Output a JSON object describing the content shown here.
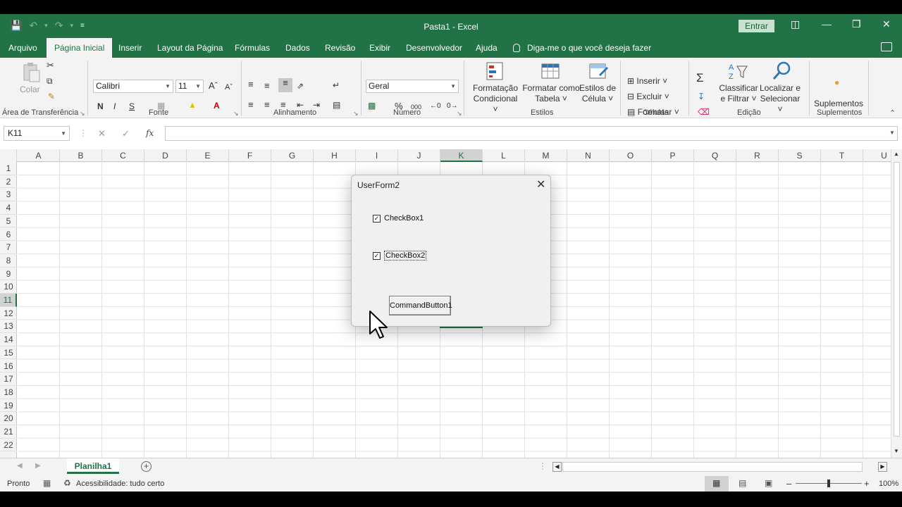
{
  "window": {
    "title": "Pasta1  -  Excel",
    "signin": "Entrar"
  },
  "tabs": [
    "Arquivo",
    "Página Inicial",
    "Inserir",
    "Layout da Página",
    "Fórmulas",
    "Dados",
    "Revisão",
    "Exibir",
    "Desenvolvedor",
    "Ajuda"
  ],
  "tell_me": "Diga-me o que você deseja fazer",
  "ribbon": {
    "clipboard": {
      "paste": "Colar",
      "label": "Área de Transferência"
    },
    "font": {
      "name": "Calibri",
      "size": "11",
      "label": "Fonte",
      "bold": "N",
      "italic": "I",
      "underline": "S"
    },
    "alignment": {
      "label": "Alinhamento"
    },
    "number": {
      "format": "Geral",
      "label": "Número",
      "percent": "%",
      "thousands": "000"
    },
    "styles": {
      "conditional": [
        "Formatação",
        "Condicional"
      ],
      "table": [
        "Formatar como",
        "Tabela"
      ],
      "cell": [
        "Estilos de",
        "Célula"
      ],
      "label": "Estilos"
    },
    "cells": {
      "insert": "Inserir",
      "delete": "Excluir",
      "format": "Formatar",
      "label": "Células"
    },
    "editing": {
      "sort": [
        "Classificar",
        "e Filtrar"
      ],
      "find": [
        "Localizar e",
        "Selecionar"
      ],
      "label": "Edição"
    },
    "addins": {
      "button": "Suplementos",
      "label": "Suplementos"
    }
  },
  "formula_bar": {
    "name_box": "K11",
    "fx": "fx",
    "value": ""
  },
  "columns": [
    "A",
    "B",
    "C",
    "D",
    "E",
    "F",
    "G",
    "H",
    "I",
    "J",
    "K",
    "L",
    "M",
    "N",
    "O",
    "P",
    "Q",
    "R",
    "S",
    "T",
    "U"
  ],
  "rows": [
    "1",
    "2",
    "3",
    "4",
    "5",
    "6",
    "7",
    "8",
    "9",
    "10",
    "11",
    "12",
    "13",
    "14",
    "15",
    "16",
    "17",
    "18",
    "19",
    "20",
    "21",
    "22"
  ],
  "selected": {
    "column": "K",
    "row": "11"
  },
  "sheets": [
    "Planilha1"
  ],
  "status": {
    "ready": "Pronto",
    "accessibility": "Acessibilidade: tudo certo",
    "zoom": "100%"
  },
  "userform": {
    "title": "UserForm2",
    "checkbox1": {
      "label": "CheckBox1",
      "checked": true
    },
    "checkbox2": {
      "label": "CheckBox2",
      "checked": true
    },
    "button": "CommandButton1"
  },
  "colors": {
    "excel_green": "#217346"
  }
}
